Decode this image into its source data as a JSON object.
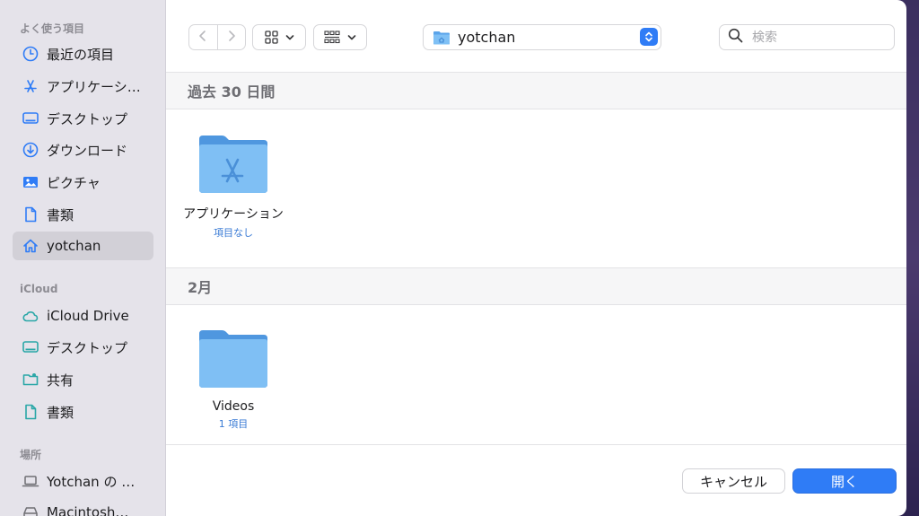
{
  "sidebar": {
    "favorites_title": "よく使う項目",
    "favorites": [
      {
        "label": "最近の項目",
        "icon": "clock-icon"
      },
      {
        "label": "アプリケーシ…",
        "icon": "app-store-icon"
      },
      {
        "label": "デスクトップ",
        "icon": "desktop-icon"
      },
      {
        "label": "ダウンロード",
        "icon": "download-icon"
      },
      {
        "label": "ピクチャ",
        "icon": "photo-icon"
      },
      {
        "label": "書類",
        "icon": "document-icon"
      },
      {
        "label": "yotchan",
        "icon": "home-icon"
      }
    ],
    "icloud_title": "iCloud",
    "icloud": [
      {
        "label": "iCloud Drive",
        "icon": "cloud-icon"
      },
      {
        "label": "デスクトップ",
        "icon": "desktop-icon"
      },
      {
        "label": "共有",
        "icon": "shared-folder-icon"
      },
      {
        "label": "書類",
        "icon": "document-icon"
      }
    ],
    "locations_title": "場所",
    "locations": [
      {
        "label": "Yotchan の …",
        "icon": "laptop-icon"
      },
      {
        "label": "Macintosh…",
        "icon": "disk-icon"
      }
    ]
  },
  "toolbar": {
    "current_folder": "yotchan",
    "search_placeholder": "検索"
  },
  "sections": [
    {
      "title": "過去 30 日間",
      "items": [
        {
          "name": "アプリケーション",
          "sub": "項目なし",
          "icon": "app-folder-icon"
        }
      ]
    },
    {
      "title": "2月",
      "items": [
        {
          "name": "Videos",
          "sub": "1 項目",
          "icon": "folder-icon"
        }
      ]
    }
  ],
  "buttons": {
    "cancel": "キャンセル",
    "open": "開く"
  },
  "colors": {
    "accent": "#2f7cf6",
    "folder": "#6fb4f0",
    "sidebar_bg": "#e5e3ea",
    "sidebar_icon": "#2f7cf6",
    "icloud_icon": "#2aa7a7"
  }
}
